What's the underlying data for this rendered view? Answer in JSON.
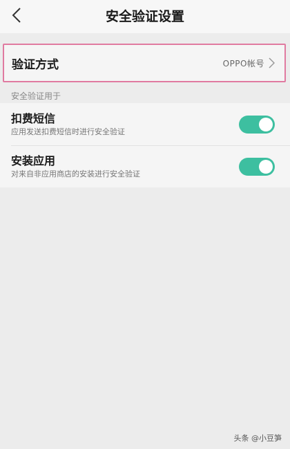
{
  "header": {
    "title": "安全验证设置"
  },
  "verify_method": {
    "label": "验证方式",
    "value": "OPPO帐号"
  },
  "section": {
    "label": "安全验证用于"
  },
  "settings": [
    {
      "title": "扣费短信",
      "subtitle": "应用发送扣费短信时进行安全验证",
      "enabled": true
    },
    {
      "title": "安装应用",
      "subtitle": "对来自非应用商店的安装进行安全验证",
      "enabled": true
    }
  ],
  "accent_color": "#3dbfa0",
  "highlight_color": "#e07aa0",
  "watermark": "头条 @小豆笋"
}
